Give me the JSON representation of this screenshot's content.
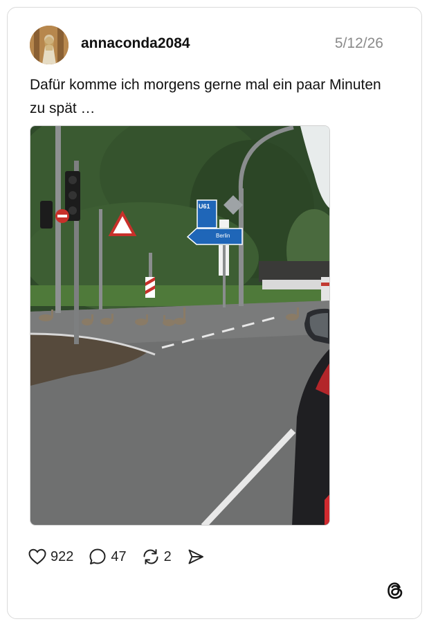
{
  "post": {
    "username": "annaconda2084",
    "date": "5/12/26",
    "text": "Dafür komme ich morgens gerne mal ein paar Minuten zu spät …"
  },
  "photo_signs": {
    "route": "U61",
    "direction": "Berlin"
  },
  "actions": {
    "likes": "922",
    "replies": "47",
    "reposts": "2"
  },
  "icons": {
    "like": "heart-icon",
    "reply": "speech-bubble-icon",
    "repost": "repost-arrows-icon",
    "share": "send-icon",
    "brand": "threads-logo-icon"
  }
}
